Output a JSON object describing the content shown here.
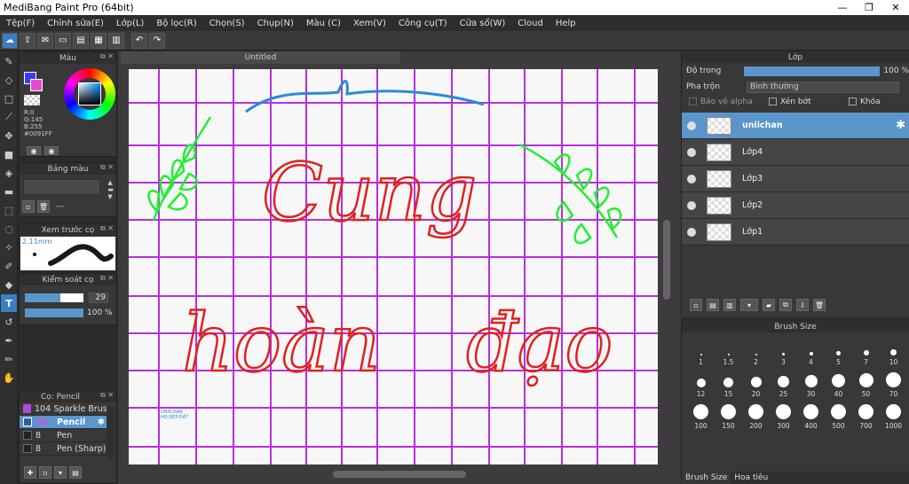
{
  "window": {
    "title": "MediBang Paint Pro (64bit)",
    "minimize": "—",
    "restore": "❐",
    "close": "✕"
  },
  "menu": [
    "Tệp(F)",
    "Chỉnh sửa(E)",
    "Lớp(L)",
    "Bộ lọc(R)",
    "Chọn(S)",
    "Chụp(N)",
    "Màu (C)",
    "Xem(V)",
    "Công cụ(T)",
    "Cửa sổ(W)",
    "Cloud",
    "Help"
  ],
  "color_panel": {
    "title": "Màu",
    "r": "R:0",
    "g": "G:145",
    "b": "B:255",
    "hex": "#0091FF",
    "fg_color": "#0091ff"
  },
  "palette_panel": {
    "title": "Bảng màu",
    "extra": "---"
  },
  "preview_panel": {
    "title": "Xem trước cọ",
    "size": "2.11mm"
  },
  "control_panel": {
    "title": "Kiểm soát cọ",
    "size_value": "29",
    "size_fraction": 0.6,
    "opacity_value": "100 %",
    "opacity_fraction": 1.0
  },
  "brush_list_panel": {
    "title": "Cọ: Pencil",
    "items": [
      {
        "size": "104",
        "name": "Sparkle Brush",
        "color": "#b04be0"
      },
      {
        "size": "29",
        "name": "Pencil",
        "color": "#e84bd0"
      },
      {
        "size": "8",
        "name": "Pen",
        "color": "#222222"
      },
      {
        "size": "8",
        "name": "Pen (Sharp)",
        "color": "#222222"
      }
    ]
  },
  "document": {
    "tab_title": "Untitled",
    "signature": "UNIICHAN\nHỌ ĐẸP ĐẤT"
  },
  "layer_panel": {
    "title": "Lớp",
    "opacity_label": "Độ trong",
    "opacity_value": "100 %",
    "opacity_fraction": 1.0,
    "blend_label": "Pha trộn",
    "blend_value": "Bình thường",
    "protect_alpha": "Bảo vệ alpha",
    "clipping": "Xén bớt",
    "lock": "Khóa",
    "layers": [
      {
        "name": "uniichan",
        "selected": true
      },
      {
        "name": "Lớp4",
        "selected": false
      },
      {
        "name": "Lớp3",
        "selected": false
      },
      {
        "name": "Lớp2",
        "selected": false
      },
      {
        "name": "Lớp1",
        "selected": false
      }
    ]
  },
  "brush_size_panel": {
    "title": "Brush Size",
    "sizes": [
      "1",
      "1.5",
      "2",
      "3",
      "4",
      "5",
      "7",
      "10",
      "12",
      "15",
      "20",
      "25",
      "30",
      "40",
      "50",
      "70",
      "100",
      "150",
      "200",
      "300",
      "400",
      "500",
      "700",
      "1000"
    ]
  },
  "bottom_tabs": {
    "brush_size": "Brush Size",
    "hoa_tieu": "Hoa tiêu"
  }
}
